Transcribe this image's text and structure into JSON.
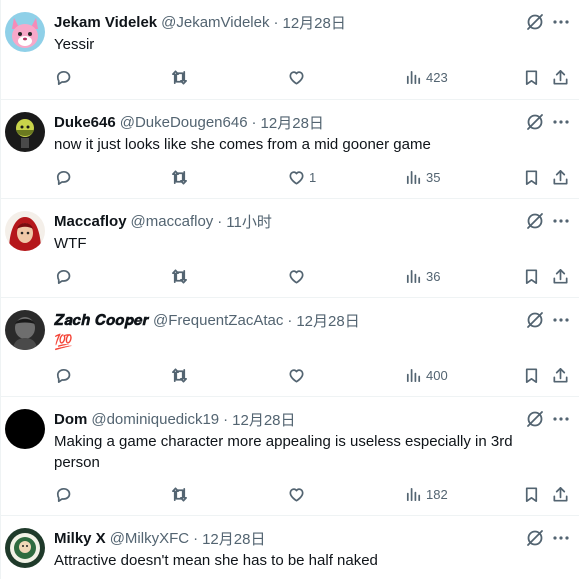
{
  "tweets": [
    {
      "name": "Jekam Videlek",
      "handle": "@JekamVidelek",
      "time": "12月28日",
      "text": "Yessir",
      "reply_count": "",
      "retweet_count": "",
      "like_count": "",
      "view_count": "423"
    },
    {
      "name": "Duke646",
      "handle": "@DukeDougen646",
      "time": "12月28日",
      "text": "now it just looks like she comes from a mid gooner game",
      "reply_count": "",
      "retweet_count": "",
      "like_count": "1",
      "view_count": "35"
    },
    {
      "name": "Maccafloy",
      "handle": "@maccafloy",
      "time": "11小时",
      "text": "WTF",
      "reply_count": "",
      "retweet_count": "",
      "like_count": "",
      "view_count": "36"
    },
    {
      "name": "𝒁𝒂𝒄𝒉 𝑪𝒐𝒐𝒑𝒆𝒓",
      "handle": "@FrequentZacAtac",
      "time": "12月28日",
      "text": "💯",
      "reply_count": "",
      "retweet_count": "",
      "like_count": "",
      "view_count": "400"
    },
    {
      "name": "Dom",
      "handle": "@dominiquedick19",
      "time": "12月28日",
      "text": "Making a game character more appealing is useless especially in 3rd person",
      "reply_count": "",
      "retweet_count": "",
      "like_count": "",
      "view_count": "182"
    },
    {
      "name": "Milky X",
      "handle": "@MilkyXFC",
      "time": "12月28日",
      "text": "Attractive doesn't mean she has to be half naked",
      "reply_count": "",
      "retweet_count": "",
      "like_count": "",
      "view_count": ""
    }
  ],
  "separator": "·",
  "icons": {
    "reply": "reply-icon",
    "retweet": "retweet-icon",
    "like": "heart-icon",
    "views": "views-chart-icon",
    "bookmark": "bookmark-icon",
    "share": "share-icon",
    "grok": "grok-icon",
    "more": "more-icon"
  },
  "colors": {
    "text": "#0f1419",
    "secondary": "#536471",
    "divider": "#eff3f4"
  }
}
